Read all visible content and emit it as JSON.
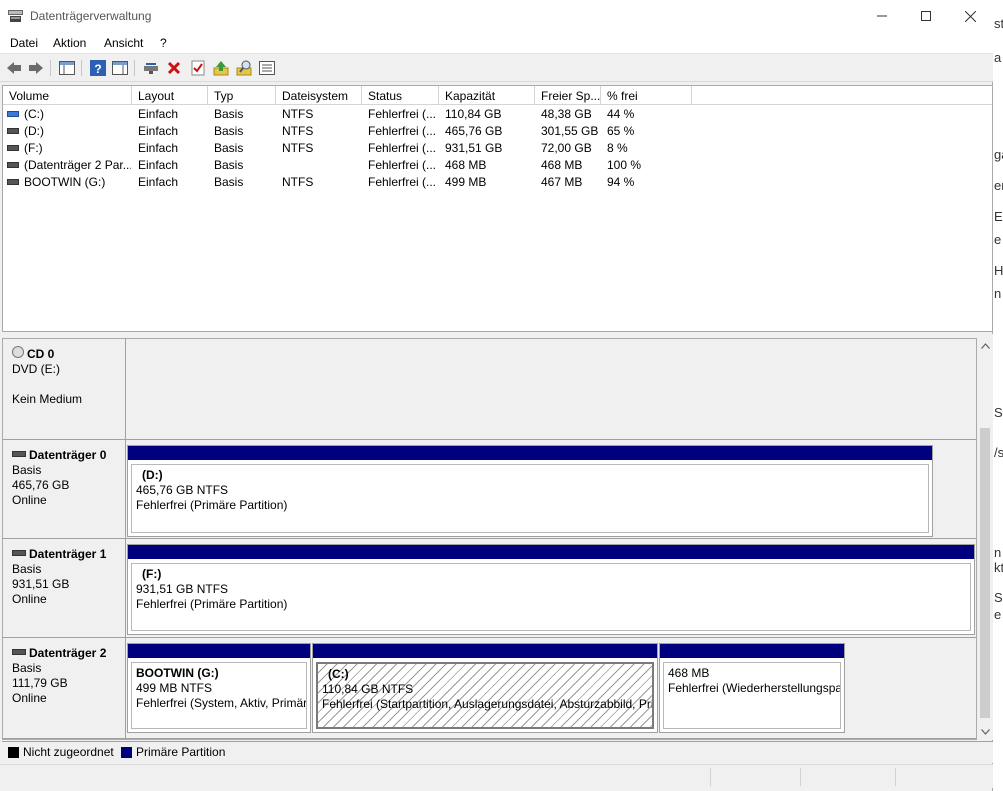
{
  "window": {
    "title": "Datenträgerverwaltung"
  },
  "menu": [
    "Datei",
    "Aktion",
    "Ansicht",
    "?"
  ],
  "toolbar": {
    "buttons": [
      "back-icon",
      "forward-icon",
      "console-tree-icon",
      "help-icon",
      "properties-pane-icon",
      "connect-icon",
      "delete-icon",
      "check-icon",
      "import-icon",
      "search-icon",
      "details-icon"
    ]
  },
  "volumes": {
    "columns": [
      "Volume",
      "Layout",
      "Typ",
      "Dateisystem",
      "Status",
      "Kapazität",
      "Freier Sp...",
      "% frei"
    ],
    "rows": [
      [
        "(C:)",
        "Einfach",
        "Basis",
        "NTFS",
        "Fehlerfrei (...",
        "110,84 GB",
        "48,38 GB",
        "44 %"
      ],
      [
        "(D:)",
        "Einfach",
        "Basis",
        "NTFS",
        "Fehlerfrei (...",
        "465,76 GB",
        "301,55 GB",
        "65 %"
      ],
      [
        "(F:)",
        "Einfach",
        "Basis",
        "NTFS",
        "Fehlerfrei (...",
        "931,51 GB",
        "72,00 GB",
        "8 %"
      ],
      [
        "(Datenträger 2 Par...",
        "Einfach",
        "Basis",
        "",
        "Fehlerfrei (...",
        "468 MB",
        "468 MB",
        "100 %"
      ],
      [
        "BOOTWIN (G:)",
        "Einfach",
        "Basis",
        "NTFS",
        "Fehlerfrei (...",
        "499 MB",
        "467 MB",
        "94 %"
      ]
    ]
  },
  "disks": {
    "cd0": {
      "name": "CD 0",
      "line1": "DVD (E:)",
      "line2": "Kein Medium"
    },
    "disk0": {
      "name": "Datenträger 0",
      "type": "Basis",
      "size": "465,76 GB",
      "state": "Online",
      "partitions": [
        {
          "title": "(D:)",
          "size": "465,76 GB NTFS",
          "status": "Fehlerfrei (Primäre Partition)"
        }
      ]
    },
    "disk1": {
      "name": "Datenträger 1",
      "type": "Basis",
      "size": "931,51 GB",
      "state": "Online",
      "partitions": [
        {
          "title": "(F:)",
          "size": "931,51 GB NTFS",
          "status": "Fehlerfrei (Primäre Partition)"
        }
      ]
    },
    "disk2": {
      "name": "Datenträger 2",
      "type": "Basis",
      "size": "111,79 GB",
      "state": "Online",
      "partitions": [
        {
          "title": "BOOTWIN  (G:)",
          "size": "499 MB NTFS",
          "status": "Fehlerfrei (System, Aktiv, Primär"
        },
        {
          "title": "(C:)",
          "size": "110,84 GB NTFS",
          "status": "Fehlerfrei (Startpartition, Auslagerungsdatei, Absturzabbild, Pri"
        },
        {
          "title": "",
          "size": "468 MB",
          "status": "Fehlerfrei (Wiederherstellungspa"
        }
      ]
    }
  },
  "legend": [
    {
      "label": "Nicht zugeordnet",
      "color": "#000000"
    },
    {
      "label": "Primäre Partition",
      "color": "#00007f"
    }
  ],
  "colors": {
    "primary_partition": "#00007f",
    "unallocated": "#000000"
  },
  "background_window_fragments": [
    "st",
    "a",
    "ga",
    "er",
    "E",
    "e",
    "HI",
    "n",
    "S",
    "/s",
    "n",
    "kt",
    "S",
    "e"
  ]
}
